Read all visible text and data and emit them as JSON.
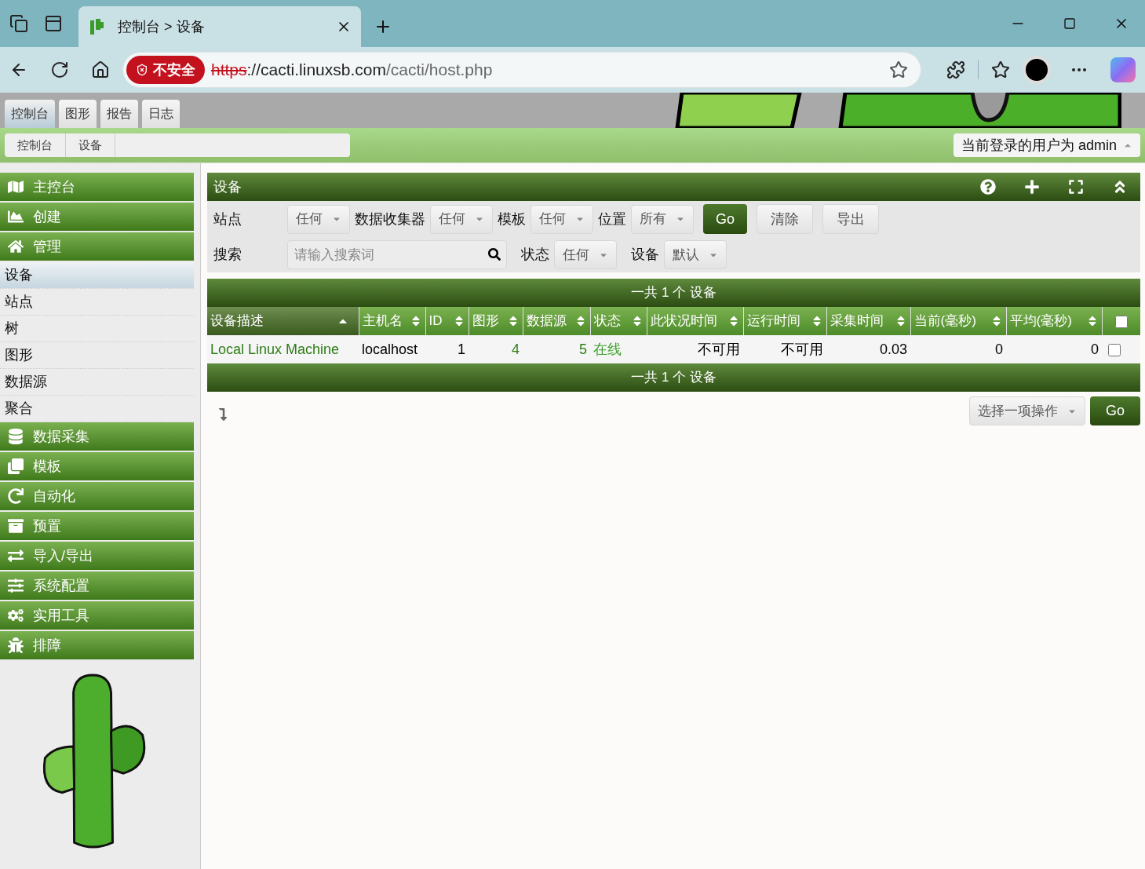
{
  "browser": {
    "tab_title": "控制台 > 设备",
    "security_badge": "不安全",
    "url_scheme": "https",
    "url_host": "://cacti.linuxsb.com",
    "url_path": "/cacti/host.php"
  },
  "top_tabs": [
    {
      "label": "控制台",
      "selected": true
    },
    {
      "label": "图形",
      "selected": false
    },
    {
      "label": "报告",
      "selected": false
    },
    {
      "label": "日志",
      "selected": false
    }
  ],
  "breadcrumbs": [
    "控制台",
    "设备"
  ],
  "user_menu": "当前登录的用户为 admin",
  "sidebar": [
    {
      "kind": "header",
      "label": "主控台"
    },
    {
      "kind": "header",
      "label": "创建"
    },
    {
      "kind": "header",
      "label": "管理"
    },
    {
      "kind": "item",
      "label": "设备",
      "selected": true
    },
    {
      "kind": "item",
      "label": "站点",
      "selected": false
    },
    {
      "kind": "item",
      "label": "树",
      "selected": false
    },
    {
      "kind": "item",
      "label": "图形",
      "selected": false
    },
    {
      "kind": "item",
      "label": "数据源",
      "selected": false
    },
    {
      "kind": "item",
      "label": "聚合",
      "selected": false
    },
    {
      "kind": "header",
      "label": "数据采集"
    },
    {
      "kind": "header",
      "label": "模板"
    },
    {
      "kind": "header",
      "label": "自动化"
    },
    {
      "kind": "header",
      "label": "预置"
    },
    {
      "kind": "header",
      "label": "导入/导出"
    },
    {
      "kind": "header",
      "label": "系统配置"
    },
    {
      "kind": "header",
      "label": "实用工具"
    },
    {
      "kind": "header",
      "label": "排障"
    }
  ],
  "panel_title": "设备",
  "filters": {
    "row1": [
      {
        "label": "站点",
        "value": "任何"
      },
      {
        "label": "数据收集器",
        "value": "任何"
      },
      {
        "label": "模板",
        "value": "任何"
      },
      {
        "label": "位置",
        "value": "所有"
      }
    ],
    "buttons": [
      "Go",
      "清除",
      "导出"
    ],
    "search_label": "搜索",
    "search_placeholder": "请输入搜索词",
    "row2": [
      {
        "label": "状态",
        "value": "任何"
      },
      {
        "label": "设备",
        "value": "默认"
      }
    ]
  },
  "summary_top": "一共 1 个 设备",
  "summary_bottom": "一共 1 个 设备",
  "table": {
    "columns": [
      {
        "label": "设备描述",
        "sorted": true
      },
      {
        "label": "主机名",
        "sorted": false
      },
      {
        "label": "ID",
        "sorted": false
      },
      {
        "label": "图形",
        "sorted": false
      },
      {
        "label": "数据源",
        "sorted": false
      },
      {
        "label": "状态",
        "sorted": false
      },
      {
        "label": "此状况时间",
        "sorted": false
      },
      {
        "label": "运行时间",
        "sorted": false
      },
      {
        "label": "采集时间",
        "sorted": false
      },
      {
        "label": "当前(毫秒)",
        "sorted": false
      },
      {
        "label": "平均(毫秒)",
        "sorted": false
      }
    ],
    "select_all_checked": false,
    "rows": [
      {
        "cells": [
          {
            "text": "Local Linux Machine",
            "kind": "link"
          },
          {
            "text": "localhost",
            "kind": "text"
          },
          {
            "text": "1",
            "kind": "text"
          },
          {
            "text": "4",
            "kind": "link"
          },
          {
            "text": "5",
            "kind": "link"
          },
          {
            "text": "在线",
            "kind": "status"
          },
          {
            "text": "不可用",
            "kind": "text"
          },
          {
            "text": "不可用",
            "kind": "text"
          },
          {
            "text": "0.03",
            "kind": "text"
          },
          {
            "text": "0",
            "kind": "text"
          },
          {
            "text": "0",
            "kind": "text"
          }
        ],
        "checked": false
      }
    ]
  },
  "action_select": "选择一项操作",
  "action_go": "Go"
}
